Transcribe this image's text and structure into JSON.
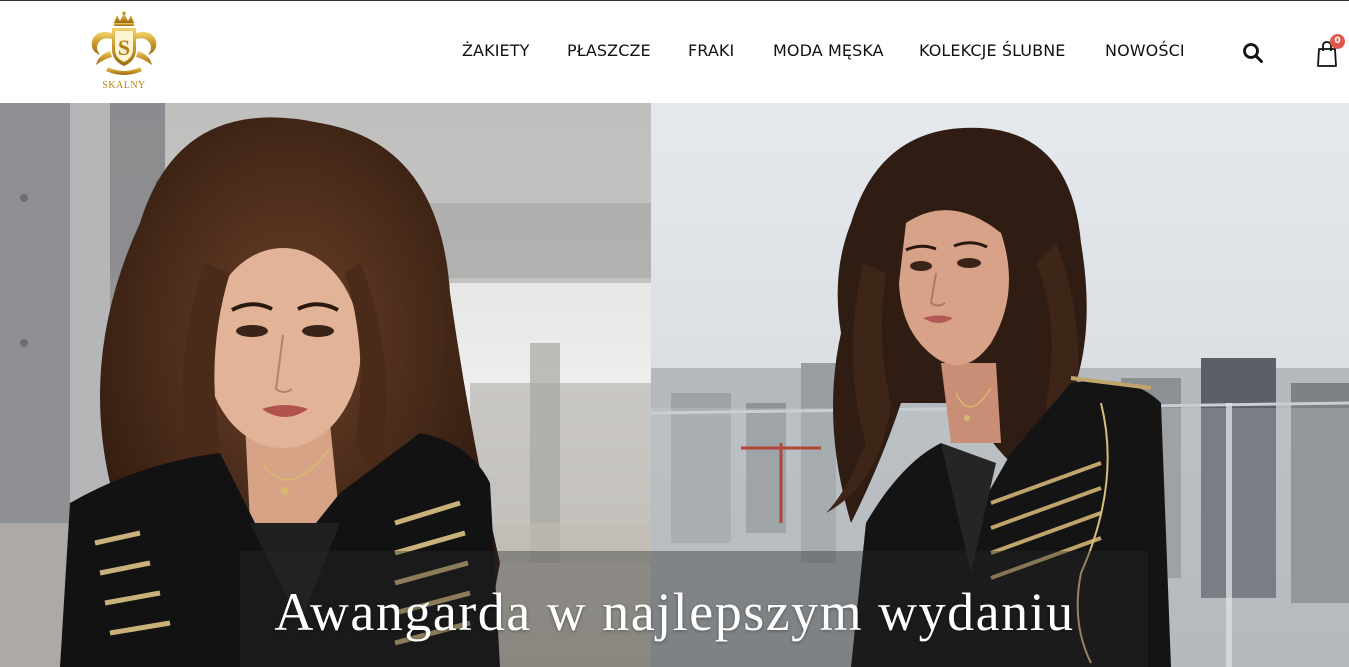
{
  "header": {
    "logo_text": "SKALNY",
    "logo_monogram": "S",
    "logo_icon": "crown-crest-icon"
  },
  "nav": {
    "items": [
      {
        "label": "ŻAKIETY"
      },
      {
        "label": "PŁASZCZE"
      },
      {
        "label": "FRAKI"
      },
      {
        "label": "MODA MĘSKA"
      },
      {
        "label": "KOLEKCJE ŚLUBNE"
      },
      {
        "label": "NOWOŚCI"
      }
    ],
    "search_icon": "search-icon",
    "cart_icon": "shopping-bag-icon",
    "cart_count": "0"
  },
  "hero": {
    "caption": "Awangarda w najlepszym wydaniu"
  },
  "colors": {
    "brand_gold": "#c9a227",
    "badge": "#e2574c",
    "text": "#111111"
  }
}
